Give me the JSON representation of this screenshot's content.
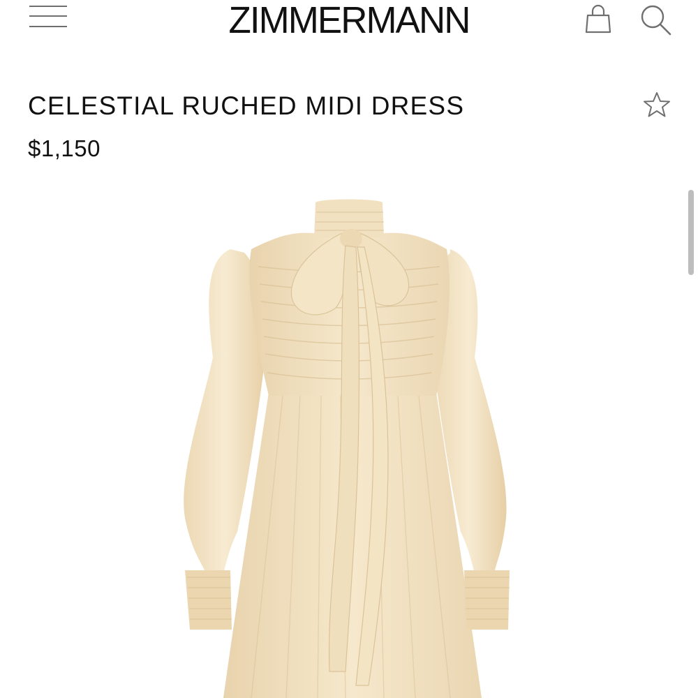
{
  "header": {
    "brand": "ZIMMERMANN",
    "icons": {
      "menu": "hamburger-icon",
      "bag": "shopping-bag-icon",
      "search": "search-icon"
    }
  },
  "product": {
    "title": "CELESTIAL RUCHED MIDI DRESS",
    "price": "$1,150",
    "wishlist_icon": "star-outline-icon",
    "image_colors": {
      "fabric": "#f3e3c3",
      "fabric_shadow": "#e2cba2",
      "fabric_highlight": "#f9eed6"
    }
  },
  "colors": {
    "text": "#111111",
    "icon_gray": "#6f6f6f",
    "scrollbar": "#bdbdbd"
  }
}
